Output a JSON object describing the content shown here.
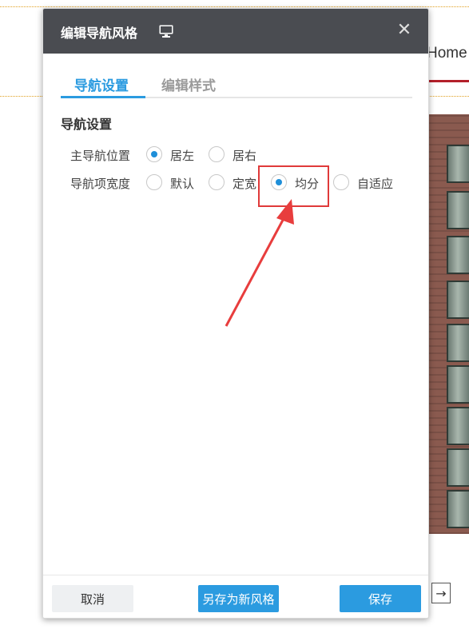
{
  "background": {
    "nav_home": "Home",
    "arrow_button_icon": "arrow-right-icon",
    "accent_color": "#b3202a"
  },
  "dialog": {
    "title": "编辑导航风格",
    "title_icon": "monitor-icon",
    "close_icon": "close-icon",
    "header_color": "#4a4c51",
    "tabs": [
      {
        "label": "导航设置",
        "active": true
      },
      {
        "label": "编辑样式",
        "active": false
      }
    ],
    "section_title": "导航设置",
    "settings": {
      "position": {
        "label": "主导航位置",
        "options": [
          {
            "label": "居左",
            "checked": true
          },
          {
            "label": "居右",
            "checked": false
          }
        ]
      },
      "width": {
        "label": "导航项宽度",
        "options": [
          {
            "label": "默认",
            "checked": false
          },
          {
            "label": "定宽",
            "checked": false
          },
          {
            "label": "均分",
            "checked": true
          },
          {
            "label": "自适应",
            "checked": false
          }
        ]
      }
    },
    "footer": {
      "cancel_label": "取消",
      "save_as_label": "另存为新风格",
      "save_label": "保存"
    },
    "accent_color": "#2b9be0"
  }
}
